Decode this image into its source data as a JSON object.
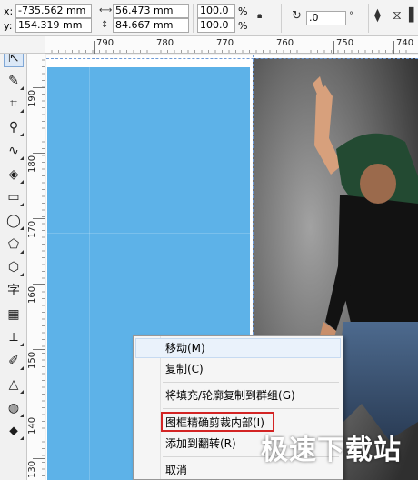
{
  "propbar": {
    "x_label": "x:",
    "x_value": "-735.562 mm",
    "y_label": "y:",
    "y_value": "154.319 mm",
    "width_value": "56.473 mm",
    "height_value": "84.667 mm",
    "scale_x": "100.0",
    "scale_y": "100.0",
    "pct1": "%",
    "pct2": "%",
    "rotation": ".0",
    "width_icon": "width-icon",
    "height_icon": "height-icon",
    "lock_icon": "lock-icon",
    "rotate_icon": "rotate-icon"
  },
  "hruler": {
    "labels": [
      "790",
      "780",
      "770",
      "760",
      "750",
      "740"
    ]
  },
  "vruler": {
    "labels": [
      "190",
      "180",
      "170",
      "160",
      "150",
      "140",
      "130"
    ]
  },
  "toolbox": {
    "tools": [
      {
        "icon": "pick-tool-icon",
        "glyph": "⇱"
      },
      {
        "icon": "shape-tool-icon",
        "glyph": "✎"
      },
      {
        "icon": "crop-tool-icon",
        "glyph": "⌗"
      },
      {
        "icon": "zoom-tool-icon",
        "glyph": "⚲"
      },
      {
        "icon": "freehand-tool-icon",
        "glyph": "∿"
      },
      {
        "icon": "smart-fill-icon",
        "glyph": "◈"
      },
      {
        "icon": "rectangle-tool-icon",
        "glyph": "▭"
      },
      {
        "icon": "ellipse-tool-icon",
        "glyph": "◯"
      },
      {
        "icon": "polygon-tool-icon",
        "glyph": "⬠"
      },
      {
        "icon": "basic-shapes-icon",
        "glyph": "⬡"
      },
      {
        "icon": "text-tool-icon",
        "glyph": "字"
      },
      {
        "icon": "table-tool-icon",
        "glyph": "▦"
      },
      {
        "icon": "parallel-dimension-icon",
        "glyph": "⟂"
      },
      {
        "icon": "eyedropper-icon",
        "glyph": "✐"
      },
      {
        "icon": "outline-pen-icon",
        "glyph": "△"
      },
      {
        "icon": "fill-tool-icon",
        "glyph": "◍"
      },
      {
        "icon": "interactive-fill-icon",
        "glyph": "⬥"
      }
    ]
  },
  "menu": {
    "items": [
      {
        "label": "移动(M)",
        "highlight": true
      },
      {
        "label": "复制(C)",
        "highlight": false
      },
      {
        "label": "将填充/轮廓复制到群组(G)",
        "highlight": false
      },
      {
        "label": "图框精确剪裁内部(I)",
        "highlight": false
      },
      {
        "label": "添加到翻转(R)",
        "highlight": false
      },
      {
        "label": "取消",
        "highlight": false
      }
    ]
  },
  "watermark": {
    "text": "极速下载站"
  },
  "colors": {
    "blue_object": "#5db2e8",
    "menu_highlight_border": "#d32424"
  }
}
